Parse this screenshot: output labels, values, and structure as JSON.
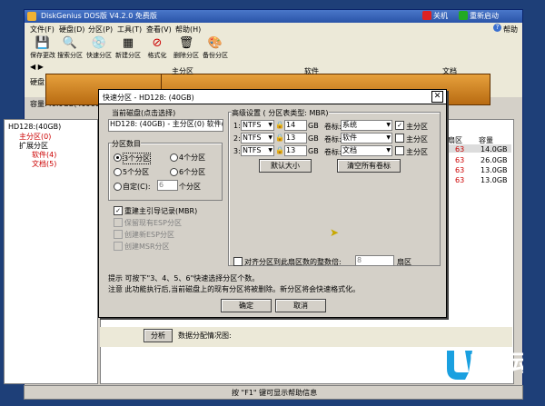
{
  "window": {
    "title": "DiskGenius DOS版 V4.2.0 免费版",
    "poweroff": "关机",
    "restart": "重新启动",
    "help": "帮助"
  },
  "menu": [
    "文件(F)",
    "硬盘(D)",
    "分区(P)",
    "工具(T)",
    "查看(V)",
    "帮助(H)"
  ],
  "toolbar": [
    "保存更改",
    "搜索分区",
    "快速分区",
    "新建分区",
    "格式化",
    "删除分区",
    "备份分区"
  ],
  "disk": {
    "label": "硬盘 0",
    "capacity": "容量:40.0GB(40960MB)",
    "segments": [
      "主分区",
      "软件",
      "文档"
    ]
  },
  "tree": [
    "HD128:(40GB)",
    "主分区(0)",
    "扩展分区",
    "软件(4)",
    "文档(5)"
  ],
  "table": {
    "headers": [
      "扇区",
      "容量"
    ],
    "rows": [
      {
        "sector": "63",
        "size": "14.0GB"
      },
      {
        "sector": "63",
        "size": "26.0GB"
      },
      {
        "sector": "63",
        "size": "13.0GB"
      },
      {
        "sector": "63",
        "size": "13.0GB"
      }
    ]
  },
  "bottom": {
    "analyze": "分析",
    "datamap": "数据分配情况图:"
  },
  "status": "按 \"F1\" 键可显示帮助信息",
  "brand": "U启动",
  "dialog": {
    "title": "快速分区 - HD128: (40GB)",
    "current_disk_label": "当前磁盘(点击选择)",
    "current_disk_value": "HD128: (40GB) - 主分区(0) 软件(4)",
    "count_label": "分区数目",
    "radios": [
      "3个分区",
      "4个分区",
      "5个分区",
      "6个分区"
    ],
    "custom_label": "自定(C):",
    "custom_value": "6",
    "custom_suffix": "个分区",
    "rebuild_mbr": "重建主引导记录(MBR)",
    "disabled_opts": [
      "保留现有ESP分区",
      "创建新ESP分区",
      "创建MSR分区"
    ],
    "advanced_label": "高级设置 ( 分区表类型: MBR)",
    "partitions": [
      {
        "num": "1:",
        "fs": "NTFS",
        "size": "14",
        "unit": "GB",
        "vol_label": "卷标:",
        "vol": "系统",
        "primary_checked": true,
        "primary": "主分区"
      },
      {
        "num": "2:",
        "fs": "NTFS",
        "size": "13",
        "unit": "GB",
        "vol_label": "卷标:",
        "vol": "软件",
        "primary_checked": false,
        "primary": "主分区"
      },
      {
        "num": "3:",
        "fs": "NTFS",
        "size": "13",
        "unit": "GB",
        "vol_label": "卷标:",
        "vol": "文档",
        "primary_checked": false,
        "primary": "主分区"
      }
    ],
    "default_size": "默认大小",
    "clear_labels": "清空所有卷标",
    "align_label": "对齐分区到此扇区数的整数倍:",
    "align_value": "8",
    "align_unit": "扇区",
    "tip1": "提示  可按下\"3、4、5、6\"快速选择分区个数。",
    "tip2": "注意  此功能执行后,当前磁盘上的现有分区将被删除。新分区将会快速格式化。",
    "ok": "确定",
    "cancel": "取消"
  }
}
